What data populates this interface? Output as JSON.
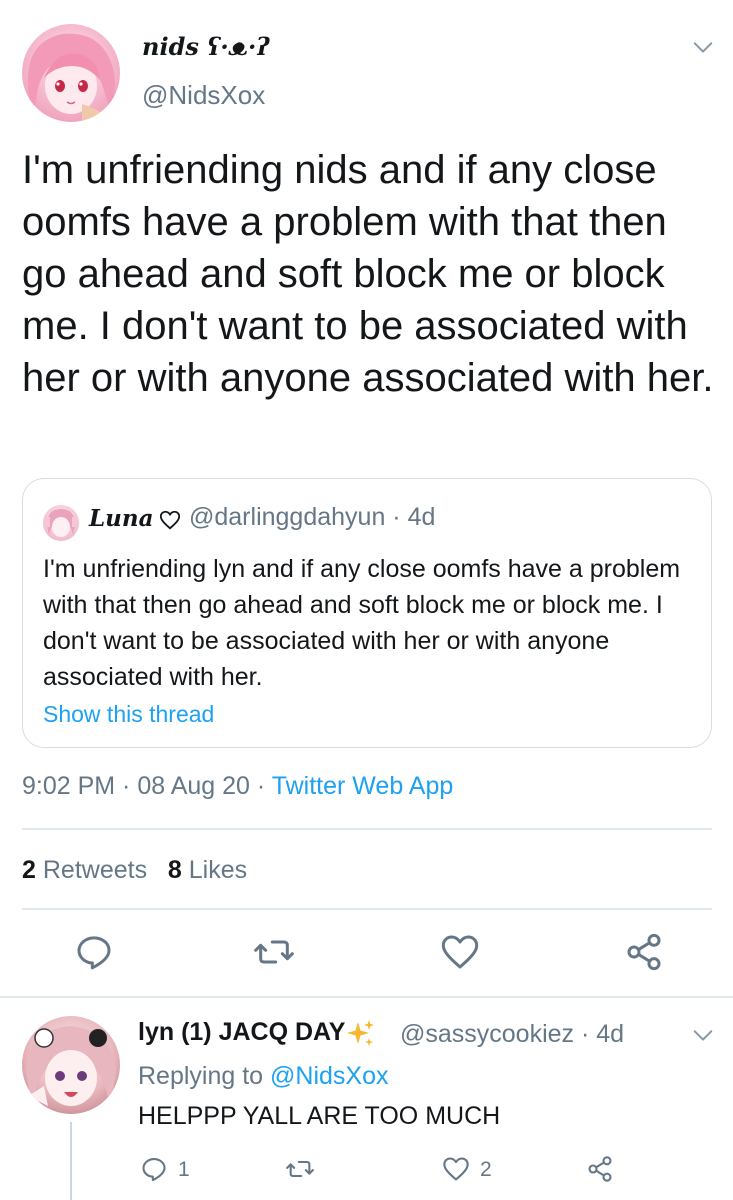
{
  "colors": {
    "link": "#1da1f2",
    "secondary_text": "#657786",
    "primary_text": "#14171a",
    "divider": "#e1e8ed"
  },
  "main_tweet": {
    "display_name": "nids ʕ·ᴥ·ʔ",
    "handle": "@NidsXox",
    "text": "I'm unfriending nids and if any close oomfs have a problem with that then go ahead and soft block me or block me. I don't want to be associated with her or with anyone associated with her.",
    "timestamp": "9:02 PM · 08 Aug 20 · ",
    "source": "Twitter Web App",
    "retweets_count": "2",
    "retweets_label": "Retweets",
    "likes_count": "8",
    "likes_label": "Likes"
  },
  "quoted_tweet": {
    "display_name": "Luna",
    "name_icon": "heart-outline-icon",
    "meta": "@darlinggdahyun · 4d",
    "text": "I'm unfriending lyn and if any close oomfs have a problem with that then go ahead and soft block me or block me. I don't want to be associated with her or with anyone associated with her.",
    "show_thread": "Show this thread"
  },
  "action_icons": [
    "reply-icon",
    "retweet-icon",
    "like-icon",
    "share-icon"
  ],
  "reply": {
    "display_name": "lyn (1) JACQ DAY",
    "name_icon": "sparkles-icon",
    "meta": "@sassycookiez · 4d",
    "replying_to_label": "Replying to ",
    "replying_to_handle": "@NidsXox",
    "text": "HELPPP YALL ARE TOO MUCH",
    "reply_count": "1",
    "like_count": "2"
  }
}
